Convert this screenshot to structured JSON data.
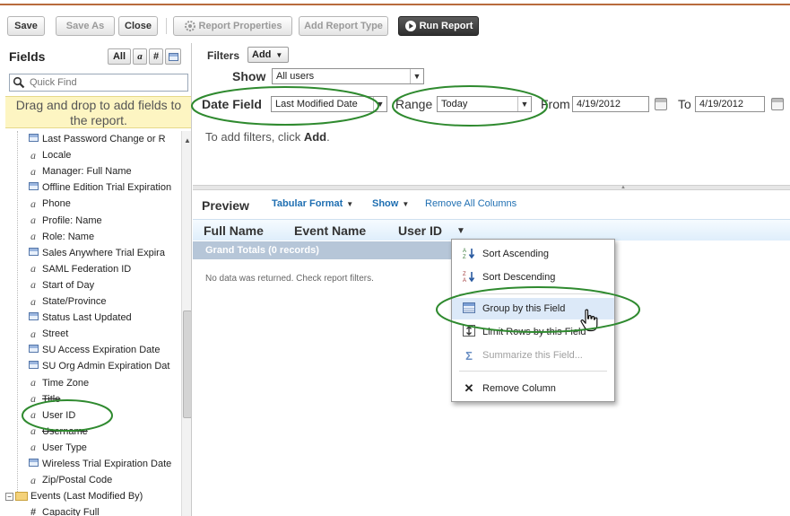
{
  "toolbar": {
    "save": "Save",
    "save_as": "Save As",
    "close": "Close",
    "report_properties": "Report Properties",
    "add_report_type": "Add Report Type",
    "run_report": "Run Report"
  },
  "fields_panel": {
    "title": "Fields",
    "filter_all": "All",
    "filter_text": "a",
    "filter_number": "#",
    "quick_find_placeholder": "Quick Find",
    "drag_message_line1": "Drag and drop to add fields to",
    "drag_message_line2": "the report.",
    "items": [
      {
        "type": "date",
        "label": "Last Password Change or R"
      },
      {
        "type": "text",
        "label": "Locale"
      },
      {
        "type": "text",
        "label": "Manager: Full Name"
      },
      {
        "type": "date",
        "label": "Offline Edition Trial Expiration"
      },
      {
        "type": "text",
        "label": "Phone"
      },
      {
        "type": "text",
        "label": "Profile: Name"
      },
      {
        "type": "text",
        "label": "Role: Name"
      },
      {
        "type": "date",
        "label": "Sales Anywhere Trial Expira"
      },
      {
        "type": "text",
        "label": "SAML Federation ID"
      },
      {
        "type": "text",
        "label": "Start of Day"
      },
      {
        "type": "text",
        "label": "State/Province"
      },
      {
        "type": "date",
        "label": "Status Last Updated"
      },
      {
        "type": "text",
        "label": "Street"
      },
      {
        "type": "date",
        "label": "SU Access Expiration Date"
      },
      {
        "type": "date",
        "label": "SU Org Admin Expiration Dat"
      },
      {
        "type": "text",
        "label": "Time Zone"
      },
      {
        "type": "text",
        "label": "Title"
      },
      {
        "type": "text",
        "label": "User ID"
      },
      {
        "type": "text",
        "label": "Username"
      },
      {
        "type": "text",
        "label": "User Type"
      },
      {
        "type": "date",
        "label": "Wireless Trial Expiration Date"
      },
      {
        "type": "text",
        "label": "Zip/Postal Code"
      }
    ],
    "folder_label": "Events (Last Modified By)",
    "folder_child": "Capacity Full"
  },
  "filters": {
    "label": "Filters",
    "add_button": "Add",
    "show_label": "Show",
    "show_value": "All users",
    "date_field_label": "Date Field",
    "date_field_value": "Last Modified Date",
    "range_label": "Range",
    "range_value": "Today",
    "from_label": "From",
    "from_value": "4/19/2012",
    "to_label": "To",
    "to_value": "4/19/2012",
    "hint_prefix": "To add filters, click ",
    "hint_bold": "Add",
    "hint_suffix": "."
  },
  "preview": {
    "title": "Preview",
    "format_link": "Tabular Format",
    "show_link": "Show",
    "remove_all": "Remove All Columns",
    "columns": [
      "Full Name",
      "Event Name",
      "User ID"
    ],
    "grand_totals": "Grand Totals (0 records)",
    "no_data": "No data was returned. Check report filters."
  },
  "column_menu": {
    "items": [
      {
        "label": "Sort Ascending",
        "icon": "sort-ascending-icon",
        "enabled": true
      },
      {
        "label": "Sort Descending",
        "icon": "sort-descending-icon",
        "enabled": true
      },
      {
        "label": "Group by this Field",
        "icon": "group-icon",
        "enabled": true
      },
      {
        "label": "Limit Rows by this Field",
        "icon": "limit-rows-icon",
        "enabled": true
      },
      {
        "label": "Summarize this Field...",
        "icon": "sigma-icon",
        "enabled": false
      },
      {
        "label": "Remove Column",
        "icon": "close-icon",
        "enabled": true
      }
    ]
  },
  "colors": {
    "highlight_oval": "#2f8a2f",
    "link": "#1f6fb2",
    "drag_message_bg": "#fdf5c2",
    "grand_totals_bg": "#b6c6d8"
  }
}
